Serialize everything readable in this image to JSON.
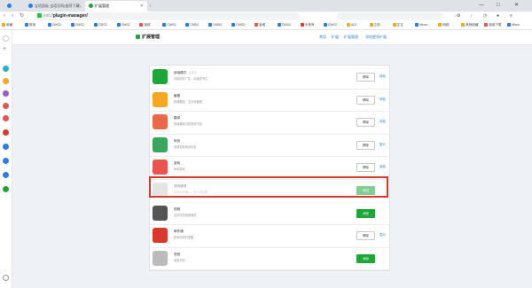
{
  "browser": {
    "tabs": [
      {
        "label": "宝塔面板 宝塔官网(推荐下载)",
        "icon_color": "#2d7be5"
      },
      {
        "label": "扩展管理",
        "icon_color": "#20a53a",
        "active": true
      }
    ],
    "new_tab": "+",
    "window_controls": [
      "—",
      "□",
      "✕"
    ],
    "url": {
      "domain": "ext://",
      "path": "plugin-manager/"
    },
    "bookmarks": [
      "收藏",
      "常用",
      "CMS2",
      "CMS2",
      "CMS2",
      "CMS2",
      "宝塔",
      "CMS2",
      "CMS2",
      "CMS2",
      "CMS2",
      "宝塔",
      "CMS2",
      "头条号",
      "CMS2",
      "413",
      "之前",
      "正文",
      "Micro",
      "网络",
      "其他收藏",
      "阅读下载",
      "Micro"
    ]
  },
  "app": {
    "title": "扩展管理",
    "nav": [
      "常用",
      "扩展",
      "扩展管理",
      "添加更多扩展"
    ]
  },
  "plugins": [
    {
      "name": "阅读模式",
      "version": "1.2.1",
      "desc": "清除网页广告，阅读更专注",
      "icon_color": "#20a53a",
      "button": "移除",
      "link": "体验"
    },
    {
      "name": "截图",
      "version": "",
      "desc": "快速截图、支持长截图",
      "icon_color": "#f5a623",
      "button": "移除",
      "link": "体验"
    },
    {
      "name": "翻译",
      "version": "",
      "desc": "快速翻译当前网页内容",
      "icon_color": "#e86a4a",
      "button": "移除",
      "link": "体验"
    },
    {
      "name": "网页",
      "version": "",
      "desc": "快速查看网页信息",
      "icon_color": "#3ba55d",
      "button": "移除",
      "link": "显示"
    },
    {
      "name": "游戏",
      "version": "",
      "desc": "休闲游戏",
      "icon_color": "#e8554e",
      "button": "移除",
      "link": "体验"
    },
    {
      "name": "搜索管理",
      "version": "",
      "desc": "支持中文输入，多个词空格",
      "icon_color": "#cfcfcf",
      "button": "添加",
      "link": "",
      "faded": true
    },
    {
      "name": "视频",
      "version": "",
      "desc": "支持在线视频播放",
      "icon_color": "#555555",
      "button": "添加",
      "link": ""
    },
    {
      "name": "邮件通",
      "version": "",
      "desc": "新邮件即时提醒",
      "icon_color": "#d9382c",
      "button": "移除",
      "link": "显示"
    },
    {
      "name": "语音",
      "version": "",
      "desc": "语音识别",
      "icon_color": "#bbbbbb",
      "button": "添加",
      "link": ""
    }
  ],
  "colors": {
    "accent": "#20a53a",
    "highlight": "#d9382c",
    "link": "#2a7fd4"
  }
}
